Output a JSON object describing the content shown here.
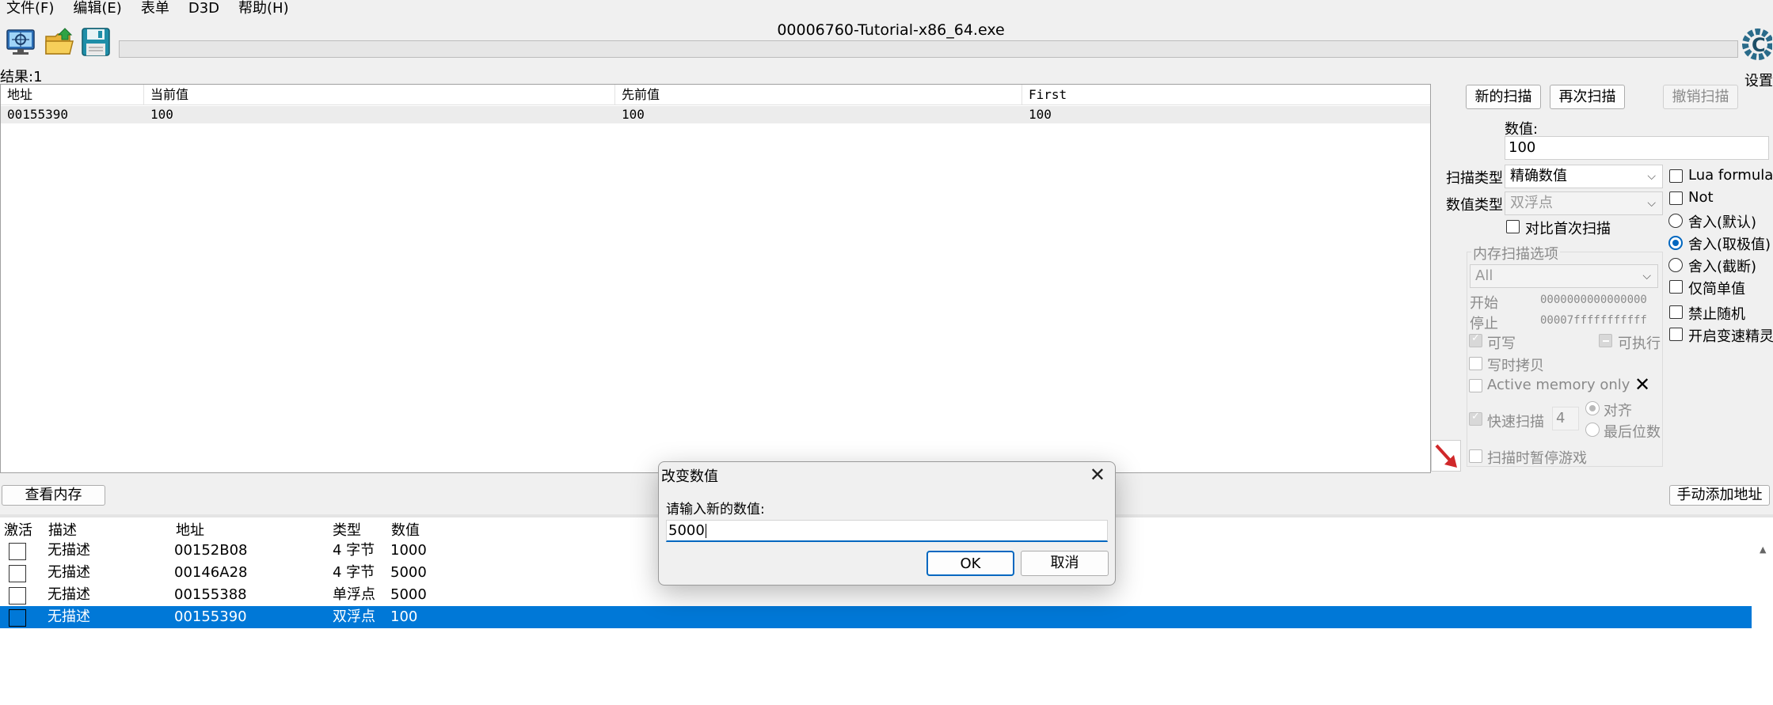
{
  "menu": [
    "文件(F)",
    "编辑(E)",
    "表单",
    "D3D",
    "帮助(H)"
  ],
  "toolbar": {
    "icons": [
      "select-process-icon",
      "open-file-icon",
      "save-file-icon"
    ]
  },
  "window_title": "00006760-Tutorial-x86_64.exe",
  "settings_label": "设置",
  "results_label": "结果:1",
  "results": {
    "columns": [
      "地址",
      "当前值",
      "先前值",
      "First"
    ],
    "rows": [
      [
        "00155390",
        "100",
        "100",
        "100"
      ]
    ]
  },
  "scan": {
    "new_scan": "新的扫描",
    "next_scan": "再次扫描",
    "undo_scan": "撤销扫描",
    "value_label": "数值:",
    "value": "100",
    "scan_type_label": "扫描类型",
    "scan_type": "精确数值",
    "value_type_label": "数值类型",
    "value_type": "双浮点",
    "compare_first": "对比首次扫描",
    "mem_group_title": "内存扫描选项",
    "region": "All",
    "start_label": "开始",
    "start_value": "0000000000000000",
    "stop_label": "停止",
    "stop_value": "00007fffffffffff",
    "writable": "可写",
    "executable": "可执行",
    "copy_on_write": "写时拷贝",
    "active_memory": "Active memory only",
    "fast_scan": "快速扫描",
    "fast_scan_value": "4",
    "align": "对齐",
    "last_digits": "最后位数",
    "pause_game": "扫描时暂停游戏"
  },
  "options": {
    "lua_formula": "Lua formula",
    "not": "Not",
    "round_default": "舍入(默认)",
    "round_extreme": "舍入(取极值)",
    "round_truncate": "舍入(截断)",
    "simple_unit": "仅简单值",
    "no_random": "禁止随机",
    "speedhack": "开启变速精灵"
  },
  "memory_view_button": "查看内存",
  "add_address_button": "手动添加地址",
  "address_list": {
    "columns": [
      "激活",
      "描述",
      "地址",
      "类型",
      "数值"
    ],
    "rows": [
      {
        "desc": "无描述",
        "addr": "00152B08",
        "type": "4 字节",
        "value": "1000"
      },
      {
        "desc": "无描述",
        "addr": "00146A28",
        "type": "4 字节",
        "value": "5000"
      },
      {
        "desc": "无描述",
        "addr": "00155388",
        "type": "单浮点",
        "value": "5000"
      },
      {
        "desc": "无描述",
        "addr": "00155390",
        "type": "双浮点",
        "value": "100"
      }
    ]
  },
  "dialog": {
    "title": "改变数值",
    "prompt": "请输入新的数值:",
    "value": "5000",
    "ok": "OK",
    "cancel": "取消"
  },
  "colors": {
    "selection": "#0078d7",
    "accent": "#0067c0"
  }
}
